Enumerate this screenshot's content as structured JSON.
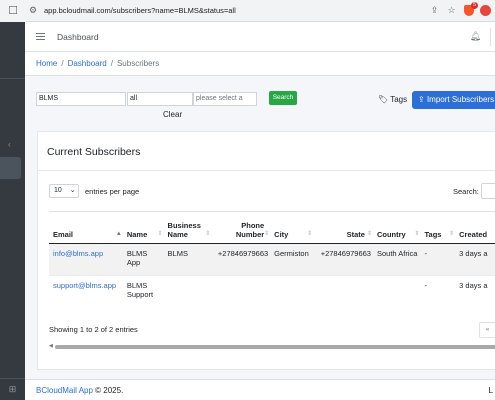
{
  "browser": {
    "url": "app.bcloudmail.com/subscribers?name=BLMS&status=all",
    "badge_count": "5"
  },
  "topnav": {
    "title": "Dashboard"
  },
  "breadcrumb": {
    "home": "Home",
    "dashboard": "Dashboard",
    "current": "Subscribers",
    "separator": "/"
  },
  "filters": {
    "name_value": "BLMS",
    "status_value": "all",
    "select_placeholder": "please select a",
    "search_label": "Search",
    "clear_label": "Clear",
    "tags_label": "Tags",
    "import_label": "Import Subscribers"
  },
  "card": {
    "title": "Current Subscribers",
    "page_length": "10",
    "entries_label": "entries per page",
    "search_label": "Search:",
    "showing": "Showing 1 to 2 of 2 entries"
  },
  "table": {
    "headers": [
      "Email",
      "Name",
      "Business Name",
      "Phone Number",
      "City",
      "State",
      "Country",
      "Tags",
      "Created"
    ],
    "rows": [
      {
        "email": "info@blms.app",
        "name": "BLMS App",
        "business": "BLMS",
        "phone": "+27846979663",
        "city": "Germiston",
        "state": "+27846979663",
        "country": "South Africa",
        "tags": "-",
        "created": "3 days a"
      },
      {
        "email": "support@blms.app",
        "name": "BLMS Support",
        "business": "",
        "phone": "",
        "city": "",
        "state": "",
        "country": "",
        "tags": "-",
        "created": "3 days a"
      }
    ]
  },
  "footer": {
    "brand": "BCloudMail App",
    "rest": "© 2025.",
    "right": "L"
  },
  "colors": {
    "primary": "#2c6fd6",
    "success": "#28a745",
    "sidebar": "#343a40"
  }
}
